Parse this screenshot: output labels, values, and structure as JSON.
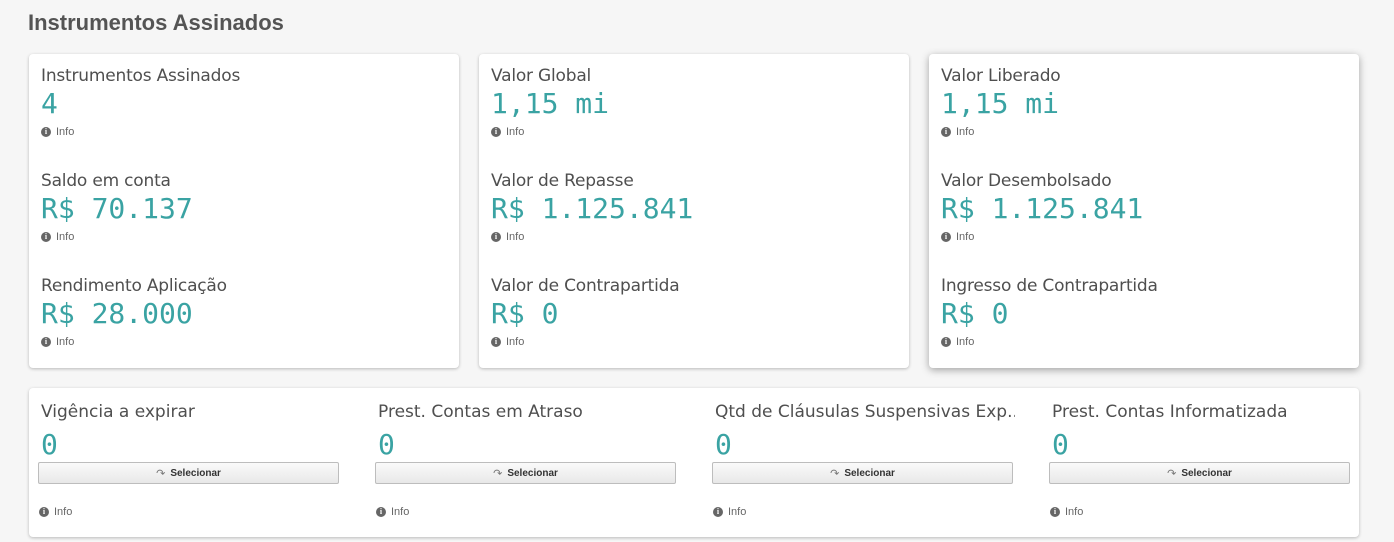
{
  "page": {
    "title": "Instrumentos Assinados"
  },
  "info_label": "Info",
  "cards": [
    {
      "items": [
        {
          "label": "Instrumentos Assinados",
          "value": "4"
        },
        {
          "label": "Saldo em conta",
          "value": "R$ 70.137"
        },
        {
          "label": "Rendimento Aplicação",
          "value": "R$ 28.000"
        }
      ]
    },
    {
      "items": [
        {
          "label": "Valor Global",
          "value": "1,15 mi"
        },
        {
          "label": "Valor de Repasse",
          "value": "R$ 1.125.841"
        },
        {
          "label": "Valor de Contrapartida",
          "value": "R$ 0"
        }
      ]
    },
    {
      "items": [
        {
          "label": "Valor Liberado",
          "value": "1,15 mi"
        },
        {
          "label": "Valor Desembolsado",
          "value": "R$ 1.125.841"
        },
        {
          "label": "Ingresso de Contrapartida",
          "value": "R$ 0"
        }
      ]
    }
  ],
  "bottom": {
    "button_label": "Selecionar",
    "items": [
      {
        "label": "Vigência a expirar",
        "value": "0"
      },
      {
        "label": "Prest. Contas em Atraso",
        "value": "0"
      },
      {
        "label": "Qtd de Cláusulas Suspensivas Exp...",
        "value": "0"
      },
      {
        "label": "Prest. Contas Informatizada",
        "value": "0"
      }
    ]
  },
  "icons": {
    "info": "info-icon",
    "select": "share-arrow-icon"
  },
  "colors": {
    "value": "#3aa3a3",
    "label": "#4f4f4f",
    "background": "#f6f6f6"
  }
}
